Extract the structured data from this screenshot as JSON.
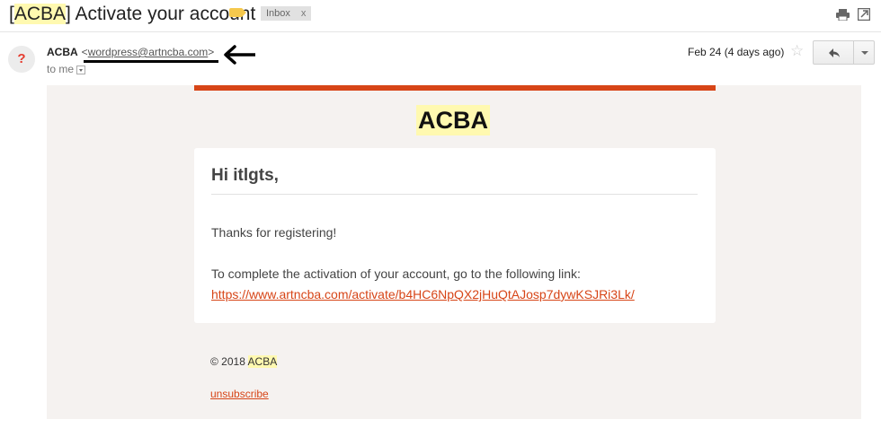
{
  "subject": {
    "bracket_open": "[",
    "brand": "ACBA",
    "rest": "] Activate your account",
    "label_chip": "Inbox",
    "label_chip_close": "x"
  },
  "header": {
    "sender_name": "ACBA",
    "sender_email": "wordpress@artncba.com",
    "to_label": "to me",
    "date": "Feb 24 (4 days ago)"
  },
  "icons": {
    "avatar": "unknown-sender-icon",
    "star": "star-icon",
    "reply": "reply-icon",
    "more": "chevron-down-icon",
    "print": "print-icon",
    "new_window": "new-window-icon",
    "annotation": "arrow-left-icon"
  },
  "email": {
    "brand": "ACBA",
    "greeting": "Hi itlgts,",
    "thanks": "Thanks for registering!",
    "instruction": "To complete the activation of your account, go to the following link:",
    "activation_link": "https://www.artncba.com/activate/b4HC6NpQX2jHuQtAJosp7dywKSJRi3Lk/",
    "copyright_prefix": "© 2018 ",
    "copyright_brand": "ACBA",
    "unsubscribe": "unsubscribe"
  },
  "colors": {
    "accent": "#d74517",
    "highlight": "#fff9b0",
    "body_background": "#f5f2f0",
    "label_tag": "#f5c84c"
  }
}
